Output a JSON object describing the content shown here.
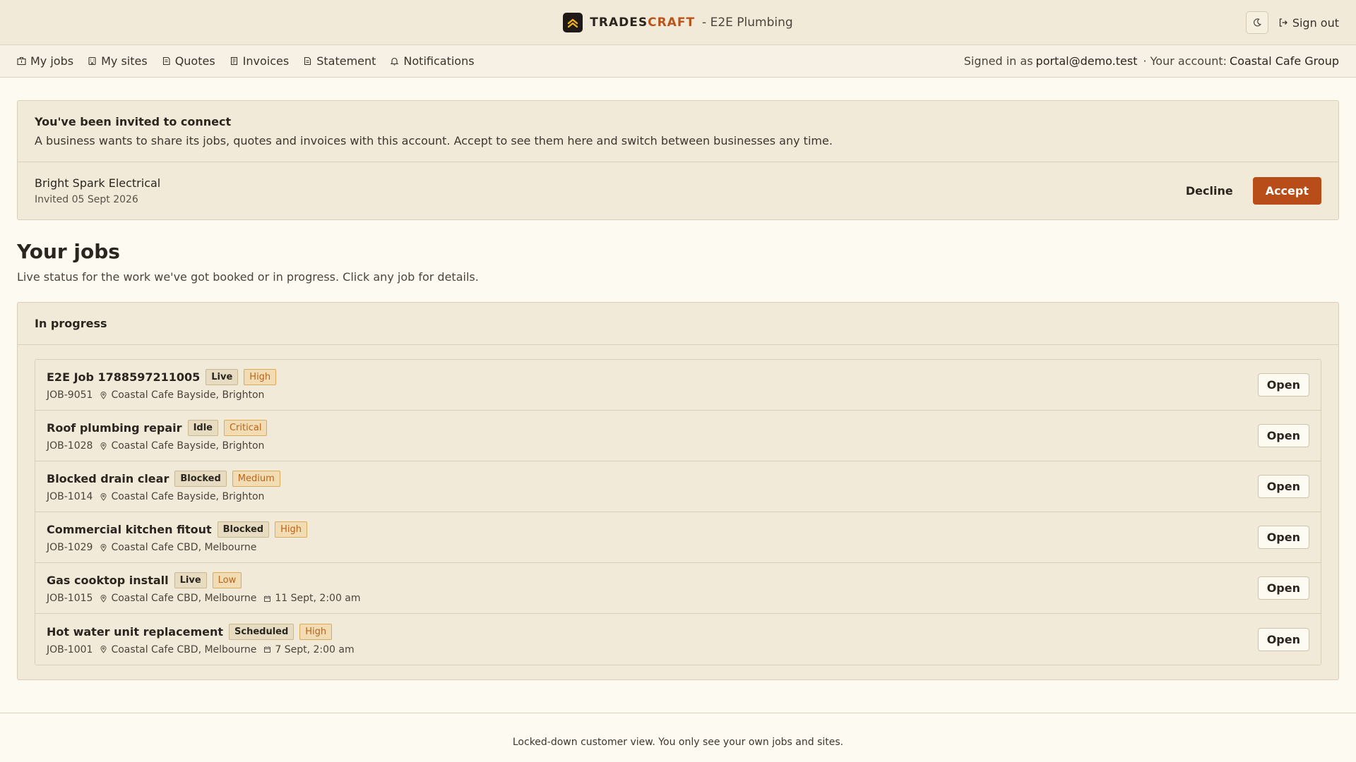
{
  "header": {
    "brand_part1": "TRADES",
    "brand_part2": "CRAFT",
    "subtitle": "- E2E Plumbing",
    "signout_label": "Sign out",
    "theme_icon": "moon-icon",
    "accent_color": "#b8541b"
  },
  "nav": {
    "items": [
      {
        "label": "My jobs",
        "icon": "briefcase-icon"
      },
      {
        "label": "My sites",
        "icon": "building-icon"
      },
      {
        "label": "Quotes",
        "icon": "quote-icon"
      },
      {
        "label": "Invoices",
        "icon": "receipt-icon"
      },
      {
        "label": "Statement",
        "icon": "document-icon"
      },
      {
        "label": "Notifications",
        "icon": "bell-icon"
      }
    ],
    "signed_in_prefix": "Signed in as",
    "signed_in_email": "portal@demo.test",
    "account_prefix": "· Your account:",
    "account_name": "Coastal Cafe Group"
  },
  "invite": {
    "title": "You've been invited to connect",
    "description": "A business wants to share its jobs, quotes and invoices with this account. Accept to see them here and switch between businesses any time.",
    "business": "Bright Spark Electrical",
    "date": "Invited 05 Sept 2026",
    "decline_label": "Decline",
    "accept_label": "Accept"
  },
  "jobs_section": {
    "title": "Your jobs",
    "subtitle": "Live status for the work we've got booked or in progress. Click any job for details.",
    "group_title": "In progress",
    "open_label": "Open",
    "jobs": [
      {
        "title": "E2E Job 1788597211005",
        "status": "Live",
        "priority": "High",
        "code": "JOB-9051",
        "site": "Coastal Cafe Bayside, Brighton",
        "time": ""
      },
      {
        "title": "Roof plumbing repair",
        "status": "Idle",
        "priority": "Critical",
        "code": "JOB-1028",
        "site": "Coastal Cafe Bayside, Brighton",
        "time": ""
      },
      {
        "title": "Blocked drain clear",
        "status": "Blocked",
        "priority": "Medium",
        "code": "JOB-1014",
        "site": "Coastal Cafe Bayside, Brighton",
        "time": ""
      },
      {
        "title": "Commercial kitchen fitout",
        "status": "Blocked",
        "priority": "High",
        "code": "JOB-1029",
        "site": "Coastal Cafe CBD, Melbourne",
        "time": ""
      },
      {
        "title": "Gas cooktop install",
        "status": "Live",
        "priority": "Low",
        "code": "JOB-1015",
        "site": "Coastal Cafe CBD, Melbourne",
        "time": "11 Sept, 2:00 am"
      },
      {
        "title": "Hot water unit replacement",
        "status": "Scheduled",
        "priority": "High",
        "code": "JOB-1001",
        "site": "Coastal Cafe CBD, Melbourne",
        "time": "7 Sept, 2:00 am"
      }
    ]
  },
  "footer": {
    "text": "Locked-down customer view. You only see your own jobs and sites."
  }
}
